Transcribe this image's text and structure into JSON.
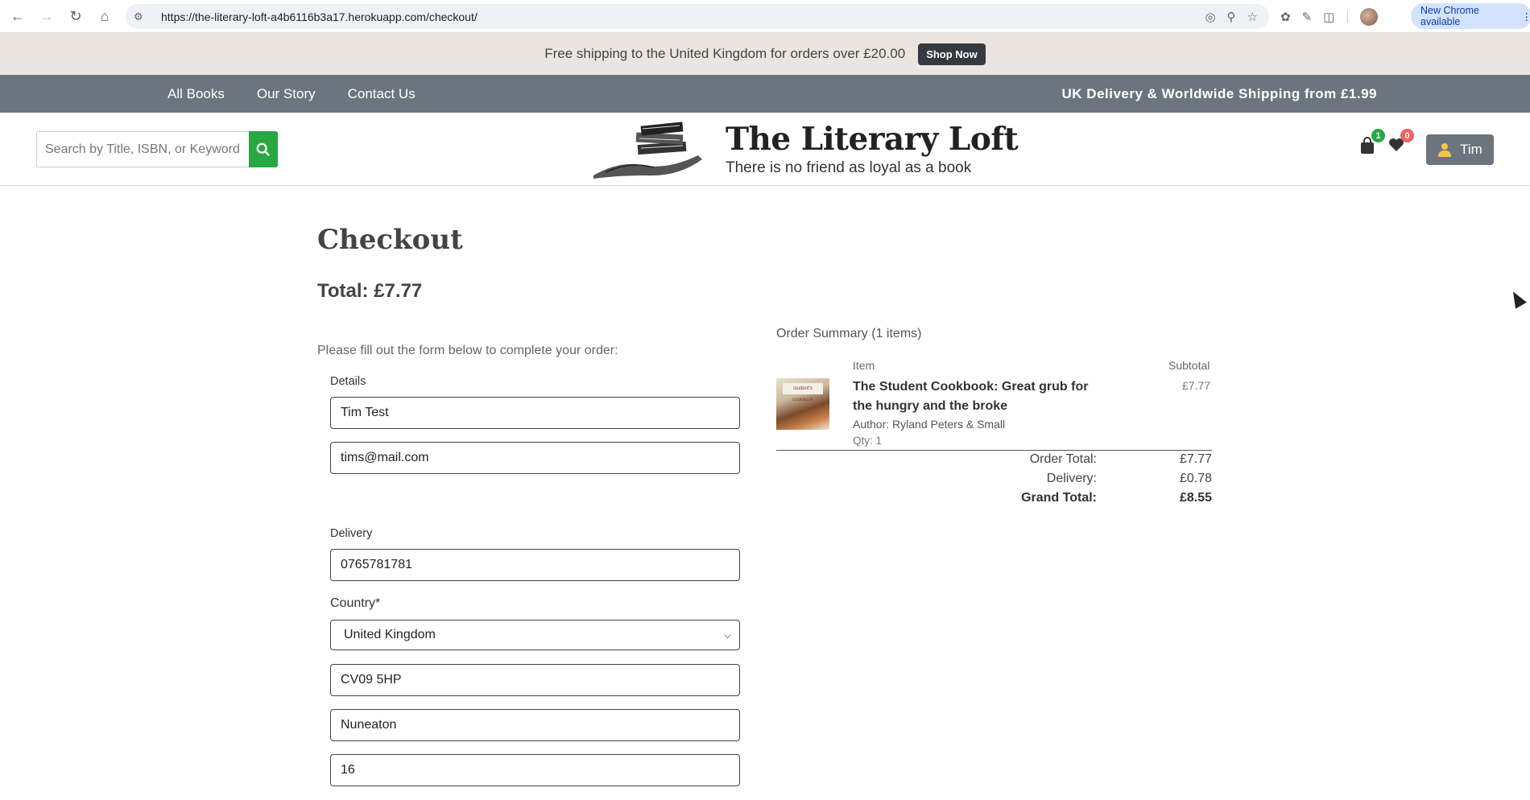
{
  "browser": {
    "url": "https://the-literary-loft-a4b6116b3a17.herokuapp.com/checkout/",
    "update_label": "New Chrome available"
  },
  "promo": {
    "text": "Free shipping to the United Kingdom for orders over £20.00",
    "button": "Shop Now"
  },
  "nav": {
    "links": [
      "All Books",
      "Our Story",
      "Contact Us"
    ],
    "shipping": "UK Delivery & Worldwide Shipping from £1.99"
  },
  "header": {
    "search_placeholder": "Search by Title, ISBN, or Keyword",
    "brand": "The Literary Loft",
    "tagline": "There is no friend as loyal as a book",
    "cart_count": "1",
    "wishlist_count": "0",
    "user": "Tim"
  },
  "checkout": {
    "title": "Checkout",
    "total": "Total: £7.77",
    "intro": "Please fill out the form below to complete your order:",
    "details_label": "Details",
    "full_name": "Tim  Test",
    "email": "tims@mail.com",
    "delivery_label": "Delivery",
    "phone": "0765781781",
    "country_label": "Country*",
    "country": "United Kingdom",
    "postcode": "CV09 5HP",
    "town": "Nuneaton",
    "address": "16"
  },
  "summary": {
    "title": "Order Summary (1 items)",
    "col_item": "Item",
    "col_subtotal": "Subtotal",
    "item": {
      "title": "The Student Cookbook: Great grub for the hungry and the broke",
      "author": "Author: Ryland Peters & Small",
      "qty": "Qty: 1",
      "subtotal": "£7.77",
      "cover_text": "student's cookbook"
    },
    "order_total_label": "Order Total:",
    "order_total": "£7.77",
    "delivery_label": "Delivery:",
    "delivery": "£0.78",
    "grand_total_label": "Grand Total:",
    "grand_total": "£8.55"
  }
}
